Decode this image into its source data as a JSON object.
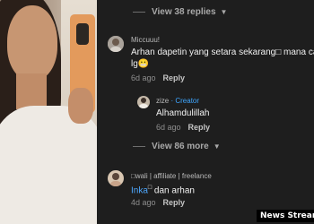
{
  "thread": {
    "view_more_top": "View 38 replies",
    "comment1": {
      "username": "Miccuuu!",
      "text_line1": "Arhan dapetin yang setara sekarang□ mana cal",
      "text_line2": "lg😬",
      "time": "6d ago",
      "reply_label": "Reply"
    },
    "reply1": {
      "username": "zize",
      "creator_label": "· Creator",
      "text": "Alhamdulillah",
      "time": "6d ago",
      "reply_label": "Reply"
    },
    "view_more_middle": "View 86 more",
    "comment2": {
      "username": "□wali | affiliate | freelance",
      "mention": "Inka",
      "mention_suffix": "□",
      "text": " dan arhan",
      "time": "4d ago",
      "reply_label": "Reply"
    }
  },
  "watermark": "News Streams",
  "colors": {
    "background": "#1e1e1e",
    "creator": "#3ea6ff",
    "mention": "#4ea8ff"
  },
  "icons": {
    "expand": "chevron-down-icon"
  }
}
